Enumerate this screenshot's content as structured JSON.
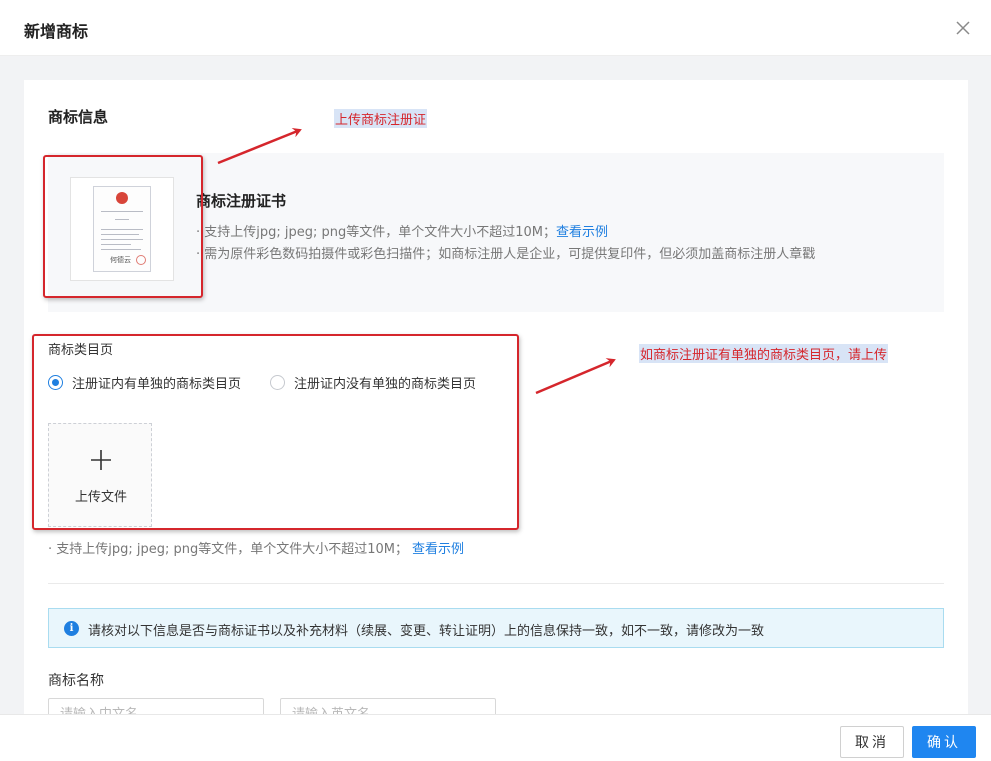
{
  "modal": {
    "title": "新增商标",
    "close_icon": "close-icon"
  },
  "trademark_info": {
    "section_title": "商标信息",
    "certificate": {
      "name": "商标注册证书",
      "hint_1": "· 支持上传jpg; jpeg; png等文件，单个文件大小不超过10M；",
      "example_link": "查看示例",
      "hint_2": "· 需为原件彩色数码拍摄件或彩色扫描件；如商标注册人是企业，可提供复印件，但必须加盖商标注册人章戳",
      "signature": "何德云"
    }
  },
  "category_page": {
    "title": "商标类目页",
    "options": [
      {
        "label": "注册证内有单独的商标类目页",
        "checked": true
      },
      {
        "label": "注册证内没有单独的商标类目页",
        "checked": false
      }
    ],
    "upload_label": "上传文件",
    "upload_hint": "· 支持上传jpg; jpeg; png等文件，单个文件大小不超过10M；",
    "example_link": "查看示例"
  },
  "notice": {
    "text": "请核对以下信息是否与商标证书以及补充材料（续展、变更、转让证明）上的信息保持一致，如不一致，请修改为一致",
    "icon": "info-icon"
  },
  "trademark_name": {
    "label": "商标名称",
    "cn_placeholder": "请输入中文名",
    "en_placeholder": "请输入英文名"
  },
  "footer": {
    "cancel_label": "取消",
    "ok_label": "确认"
  },
  "annotations": {
    "upload_cert": "上传商标注册证",
    "category_note": "如商标注册证有单独的商标类目页，请上传"
  },
  "colors": {
    "accent": "#1f86f0",
    "annotation": "#d5262c",
    "notice_bg": "#e9f6fc"
  }
}
